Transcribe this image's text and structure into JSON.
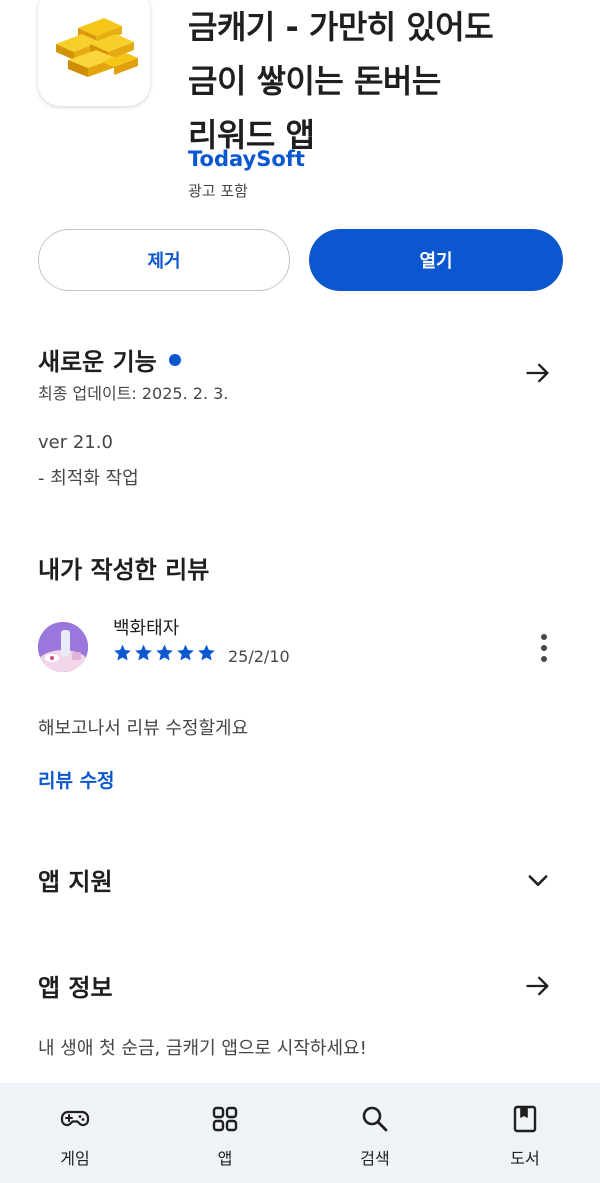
{
  "app": {
    "title_line1": "금캐기 - 가만히 있어도",
    "title_line2": "금이 쌓이는 돈버는",
    "title_line3": "리워드 앱",
    "developer": "TodaySoft",
    "ads_note": "광고 포함",
    "icon": "gold-bars-icon"
  },
  "actions": {
    "remove_label": "제거",
    "open_label": "열기"
  },
  "whats_new": {
    "title": "새로운 기능",
    "last_updated": "최종 업데이트: 2025. 2. 3.",
    "version": "ver 21.0",
    "notes": "- 최적화 작업"
  },
  "my_review": {
    "title": "내가 작성한 리뷰",
    "reviewer": "백화태자",
    "rating": 5,
    "date": "25/2/10",
    "text": "해보고나서 리뷰 수정할게요",
    "edit_link": "리뷰 수정"
  },
  "app_support": {
    "title": "앱 지원"
  },
  "app_info": {
    "title": "앱 정보",
    "description": "내 생애 첫 순금, 금캐기 앱으로 시작하세요!"
  },
  "bottom_nav": [
    {
      "label": "게임",
      "icon": "gamepad-icon"
    },
    {
      "label": "앱",
      "icon": "apps-grid-icon"
    },
    {
      "label": "검색",
      "icon": "search-icon"
    },
    {
      "label": "도서",
      "icon": "book-icon"
    }
  ],
  "colors": {
    "accent": "#0b57d0",
    "nav_background": "#eff2f7"
  }
}
